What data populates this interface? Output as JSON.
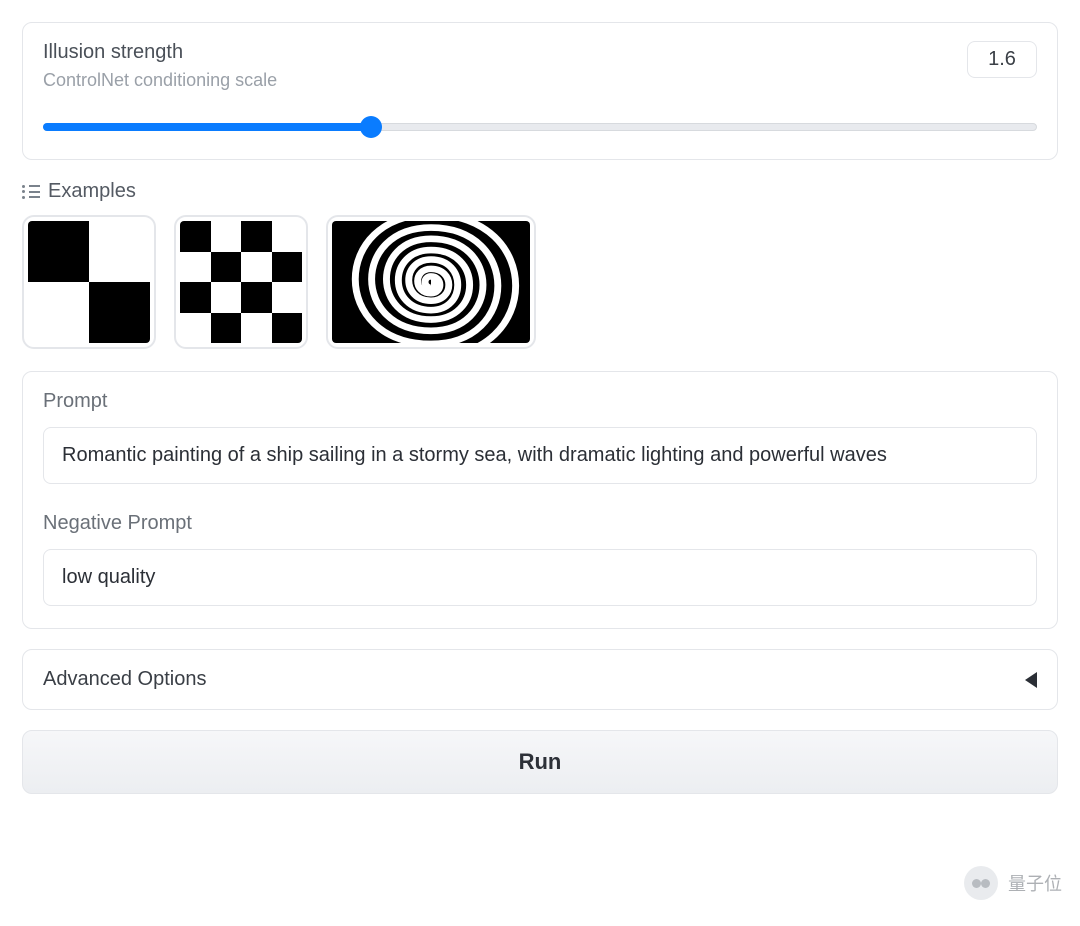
{
  "slider": {
    "label": "Illusion strength",
    "sublabel": "ControlNet conditioning scale",
    "value": "1.6",
    "fill_percent": 33
  },
  "examples": {
    "header": "Examples",
    "items": [
      {
        "name": "checker-2x2"
      },
      {
        "name": "checker-4x4"
      },
      {
        "name": "spiral"
      }
    ]
  },
  "prompt": {
    "label": "Prompt",
    "value": "Romantic painting of a ship sailing in a stormy sea, with dramatic lighting and powerful waves"
  },
  "negative_prompt": {
    "label": "Negative Prompt",
    "value": "low quality"
  },
  "advanced": {
    "label": "Advanced Options"
  },
  "run": {
    "label": "Run"
  },
  "watermark": {
    "text": "量子位"
  }
}
